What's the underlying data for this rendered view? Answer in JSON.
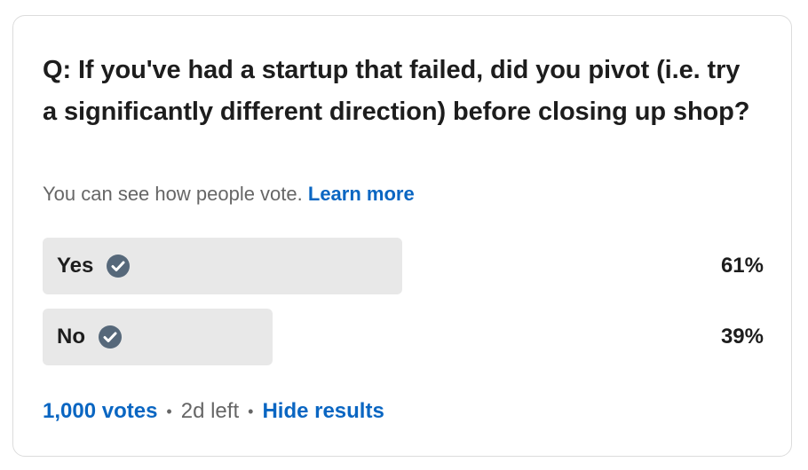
{
  "poll": {
    "question": "Q: If you've had a startup that failed, did you pivot (i.e. try a significantly different direction) before closing up shop?",
    "subtext": "You can see how people vote.",
    "learn_more": "Learn more",
    "options": [
      {
        "label": "Yes",
        "percent_text": "61%",
        "percent": 61,
        "selected": true
      },
      {
        "label": "No",
        "percent_text": "39%",
        "percent": 39,
        "selected": true
      }
    ],
    "votes": "1,000 votes",
    "time_left": "2d left",
    "hide_results": "Hide results",
    "separator": "•"
  },
  "colors": {
    "link": "#0a66c2",
    "bar": "#e8e8e8",
    "check": "#56687a",
    "muted": "#666666"
  },
  "icons": {
    "check": "check-circle-icon"
  }
}
